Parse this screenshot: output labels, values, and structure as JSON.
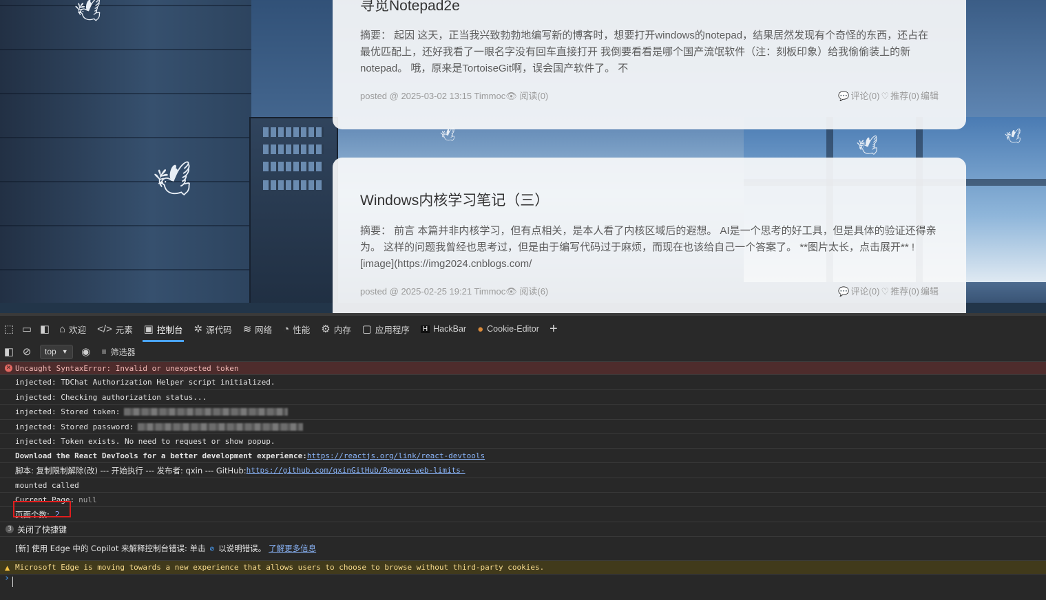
{
  "posts": [
    {
      "title": "寻觅Notepad2e",
      "summary": "摘要： 起因 这天，正当我兴致勃勃地编写新的博客时，想要打开windows的notepad，结果居然发现有个奇怪的东西，还占在最优匹配上，还好我看了一眼名字没有回车直接打开 我倒要看看是哪个国产流氓软件（注：刻板印象）给我偷偷装上的新notepad。 哦，原来是TortoiseGit啊，误会国产软件了。 不",
      "meta": "posted @ 2025-03-02 13:15 Timmoc",
      "views": "阅读(0)",
      "comments": "评论(0)",
      "likes": "推荐(0)",
      "edit": "编辑"
    },
    {
      "title": "Windows内核学习笔记（三）",
      "summary": "摘要： 前言 本篇并非内核学习，但有点相关，是本人看了内核区域后的遐想。 AI是一个思考的好工具，但是具体的验证还得亲为。 这样的问题我曾经也思考过，但是由于编写代码过于麻烦，而现在也该给自己一个答案了。 **图片太长，点击展开** ![image](https://img2024.cnblogs.com/",
      "meta": "posted @ 2025-02-25 19:21 Timmoc",
      "views": "阅读(6)",
      "comments": "评论(0)",
      "likes": "推荐(0)",
      "edit": "编辑"
    }
  ],
  "devtools": {
    "tabs": [
      {
        "label": "欢迎",
        "icon": "home-icon"
      },
      {
        "label": "元素",
        "icon": "code-icon"
      },
      {
        "label": "控制台",
        "icon": "console-icon"
      },
      {
        "label": "源代码",
        "icon": "bug-icon"
      },
      {
        "label": "网络",
        "icon": "wifi-icon"
      },
      {
        "label": "性能",
        "icon": "gauge-icon"
      },
      {
        "label": "内存",
        "icon": "memory-icon"
      },
      {
        "label": "应用程序",
        "icon": "app-icon"
      },
      {
        "label": "HackBar",
        "icon": "hackbar-icon"
      },
      {
        "label": "Cookie-Editor",
        "icon": "cookie-icon"
      }
    ],
    "active_tab": "控制台",
    "context": "top",
    "filter_label": "筛选器"
  },
  "console": {
    "error": "Uncaught SyntaxError: Invalid or unexpected token",
    "lines": [
      "injected: TDChat Authorization Helper script initialized.",
      "injected: Checking authorization status...",
      "injected: Stored token:",
      "injected: Stored password:",
      "injected: Token exists. No need to request or show popup."
    ],
    "react_text": "Download the React DevTools for a better development experience: ",
    "react_link": "https://reactjs.org/link/react-devtools",
    "script_text": "脚本: 复制限制解除(改) --- 开始执行 --- 发布者: qxin --- GitHub: ",
    "script_link": "https://github.com/qxinGitHub/Remove-web-limits-",
    "mounted": "mounted called",
    "current_page_label": "Current Page:",
    "current_page_value": "null",
    "page_count_label": "页面个数:",
    "page_count_value": "2",
    "group_count": "3",
    "group_label": "关闭了快捷键",
    "copilot_text": "[新] 使用 Edge 中的 Copilot 来解释控制台错误: 单击",
    "copilot_text2": "以说明错误。",
    "copilot_link": "了解更多信息",
    "warning": "Microsoft Edge is moving towards a new experience that allows users to choose to browse without third-party cookies."
  },
  "colors": {
    "accent": "#4aa3ff",
    "error_bg": "#4e2c2c",
    "warning_bg": "#413a1b",
    "highlight": "#e01e1e"
  }
}
